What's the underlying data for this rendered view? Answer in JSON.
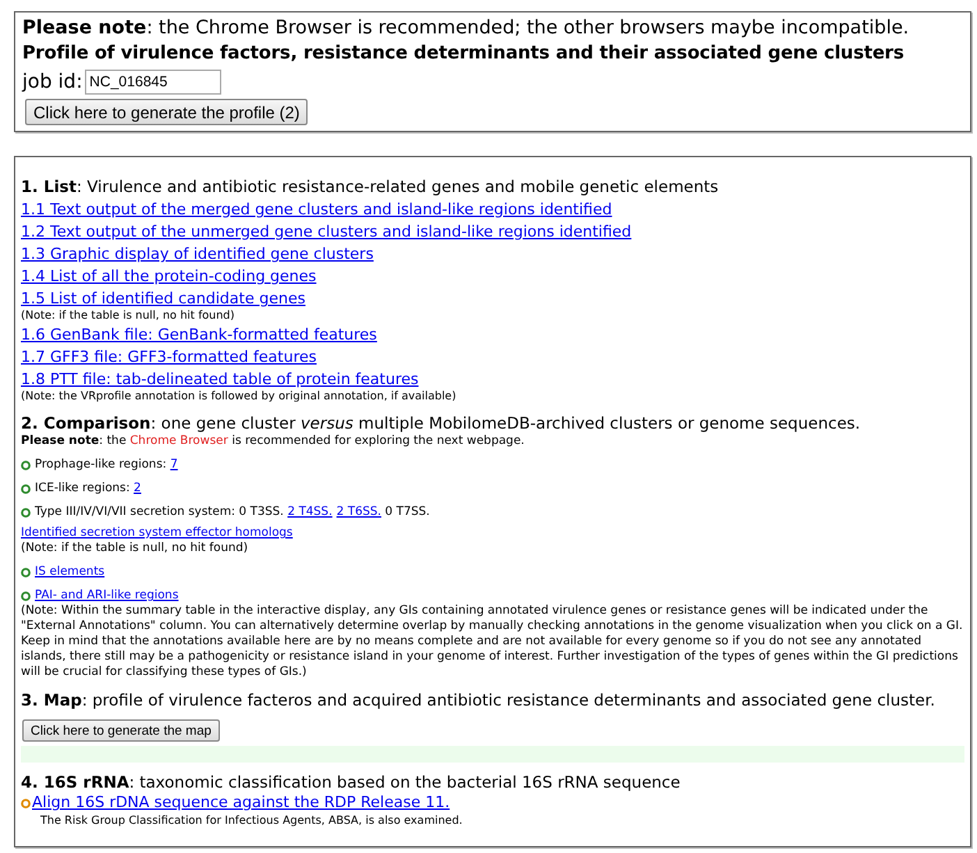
{
  "notice": "**Please note**: the Chrome Browser is recommended; the other browsers maybe incompatible.",
  "title": "Profile of virulence factors, resistance determinants and their associated gene clusters",
  "job_id": {
    "label": "job id:",
    "value": "NC_016845"
  },
  "generate_button": "Click here to generate the profile (2)",
  "sections": [
    {
      "heading": "**1. List**: Virulence and antibiotic resistance-related genes and mobile genetic elements",
      "items": [
        {
          "kind": "link",
          "text": "1.1 Text output of the merged gene clusters and island-like regions identified"
        },
        {
          "kind": "link",
          "text": "1.2 Text output of the unmerged gene clusters and island-like regions identified"
        },
        {
          "kind": "link",
          "text": "1.3 Graphic display of identified gene clusters"
        },
        {
          "kind": "link",
          "text": "1.4 List of all the protein-coding genes"
        },
        {
          "kind": "link",
          "text": "1.5 List of identified candidate genes"
        },
        {
          "kind": "note",
          "text": "(Note: if the table is null, no hit found)"
        },
        {
          "kind": "link",
          "text": "1.6 GenBank file: GenBank-formatted features"
        },
        {
          "kind": "link",
          "text": "1.7 GFF3 file: GFF3-formatted features"
        },
        {
          "kind": "link",
          "text": "1.8 PTT file: tab-delineated table of protein features"
        },
        {
          "kind": "note",
          "text": "(Note: the VRprofile annotation is followed by original annotation, if available)"
        }
      ]
    },
    {
      "heading": "**2. Comparison**: one gene cluster *versus* multiple MobilomeDB-archived clusters or genome sequences.",
      "items": [
        {
          "kind": "warning",
          "lead": "**Please note**: the",
          "highlight": "Chrome Browser",
          "rest": "is recommended for exploring the next webpage."
        },
        {
          "kind": "bullet",
          "parts": [
            {
              "kind": "text",
              "text": "Prophage-like regions: "
            },
            {
              "kind": "link",
              "text": "7"
            }
          ]
        },
        {
          "kind": "bullet",
          "parts": [
            {
              "kind": "text",
              "text": "ICE-like regions: "
            },
            {
              "kind": "link",
              "text": "2"
            }
          ]
        },
        {
          "kind": "bullet",
          "parts": [
            {
              "kind": "text",
              "text": "Type III/IV/VI/VII secretion system: 0 T3SS. "
            },
            {
              "kind": "link",
              "text": "2 T4SS."
            },
            {
              "kind": "link",
              "text": "2 T6SS."
            },
            {
              "kind": "text",
              "text": " 0 T7SS."
            }
          ]
        },
        {
          "kind": "small_link",
          "text": "Identified secretion system effector homologs"
        },
        {
          "kind": "small_note",
          "text": "(Note: if the table is null, no hit found)"
        },
        {
          "kind": "bullet",
          "parts": [
            {
              "kind": "link",
              "text": "IS elements"
            }
          ]
        },
        {
          "kind": "bullet",
          "parts": [
            {
              "kind": "link",
              "text": "PAI- and ARI-like regions"
            }
          ]
        },
        {
          "kind": "small_note",
          "text": "(Note: Within the summary table in the interactive display, any GIs containing annotated virulence genes or resistance genes will be indicated under the \"External Annotations\" column. You can alternatively determine overlap by manually checking annotations in the genome visualization when you click on a GI. Keep in mind that the annotations available here are by no means complete and are not available for every genome so if you do not see any annotated islands, there still may be a pathogenicity or resistance island in your genome of interest. Further investigation of the types of genes within the GI predictions will be crucial for classifying these types of GIs.)"
        }
      ]
    },
    {
      "heading": "**3. Map**: profile of virulence facteros and acquired antibiotic resistance determinants and associated gene cluster.",
      "items": [
        {
          "kind": "button",
          "text": "Click here to generate the map"
        },
        {
          "kind": "result_area"
        }
      ]
    },
    {
      "heading": "**4. 16S rRNA**: taxonomic classification based on the bacterial 16S rRNA sequence",
      "items": [
        {
          "kind": "link_bullet",
          "text": "Align 16S rDNA sequence against the RDP Release 11."
        },
        {
          "kind": "indented_note",
          "text": "The Risk Group Classification for Infectious Agents, ABSA, is also examined."
        }
      ]
    }
  ]
}
